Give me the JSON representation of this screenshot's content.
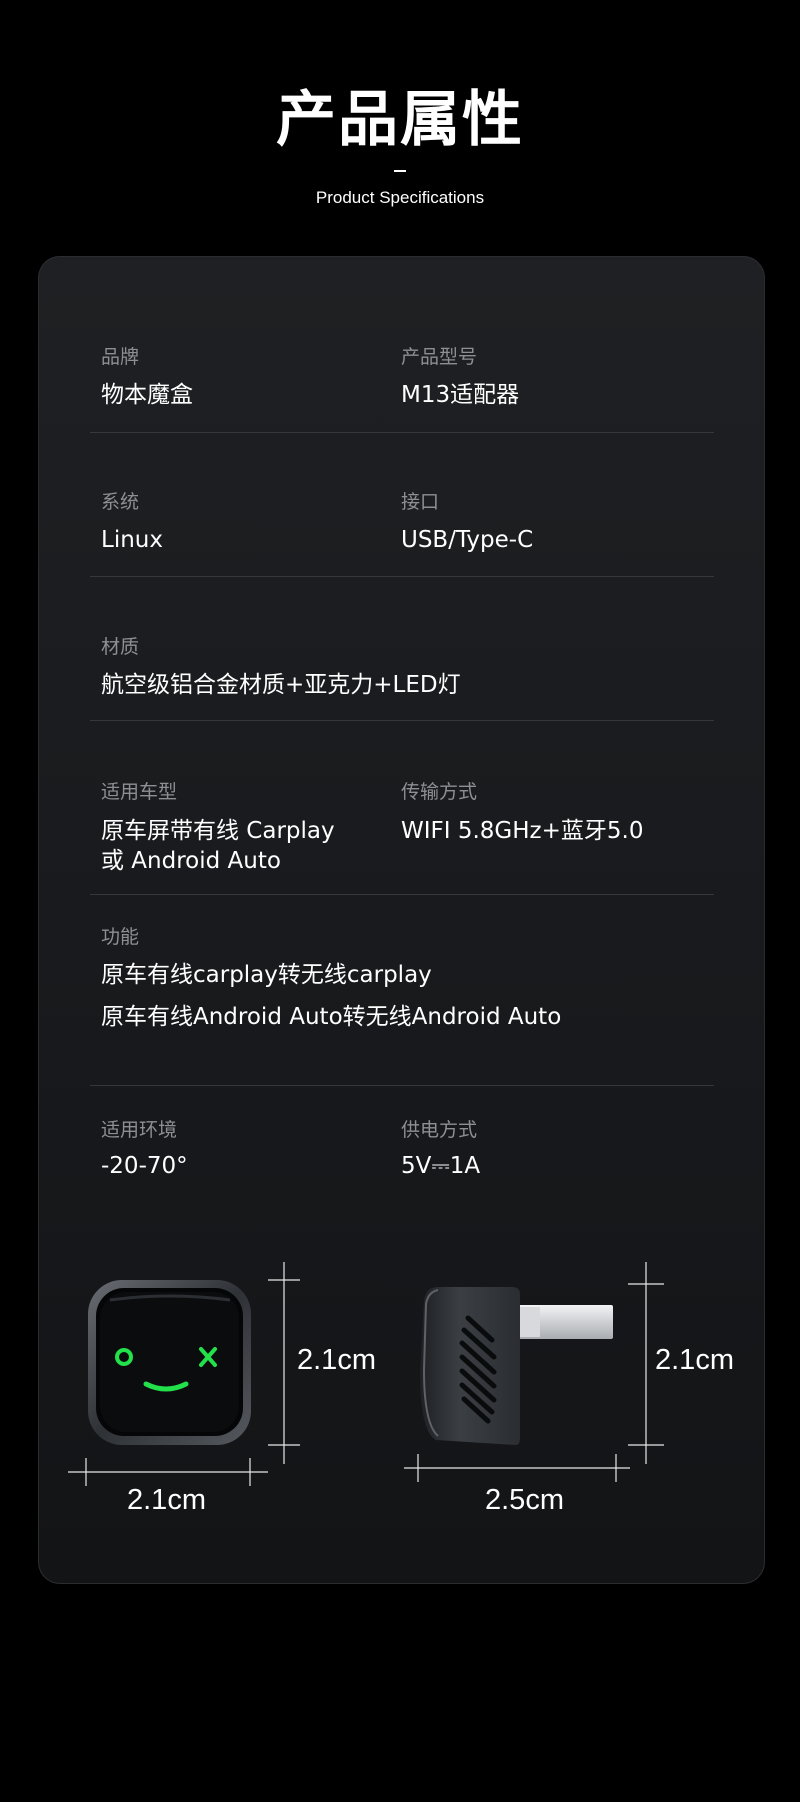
{
  "header": {
    "title": "产品属性",
    "subtitle": "Product Specifications"
  },
  "specs": {
    "brand_label": "品牌",
    "brand_value": "物本魔盒",
    "model_label": "产品型号",
    "model_value": "M13适配器",
    "system_label": "系统",
    "system_value": "Linux",
    "interface_label": "接口",
    "interface_value": "USB/Type-C",
    "material_label": "材质",
    "material_value": "航空级铝合金材质+亚克力+LED灯",
    "vehicle_label": "适用车型",
    "vehicle_value_line1": "原车屏带有线 Carplay",
    "vehicle_value_line2": "或 Android Auto",
    "transfer_label": "传输方式",
    "transfer_value": "WIFI 5.8GHz+蓝牙5.0",
    "function_label": "功能",
    "function_line1": "原车有线carplay转无线carplay",
    "function_line2": "原车有线Android Auto转无线Android Auto",
    "env_label": "适用环境",
    "env_value": "-20-70°",
    "power_label": "供电方式",
    "power_value": "5V⎓1A"
  },
  "dimensions": {
    "front_height": "2.1cm",
    "front_width": "2.1cm",
    "side_height": "2.1cm",
    "side_width": "2.5cm"
  },
  "colors": {
    "background": "#000000",
    "card": "#1b1d20",
    "label": "#8d8f93",
    "led_green": "#22e14a"
  }
}
